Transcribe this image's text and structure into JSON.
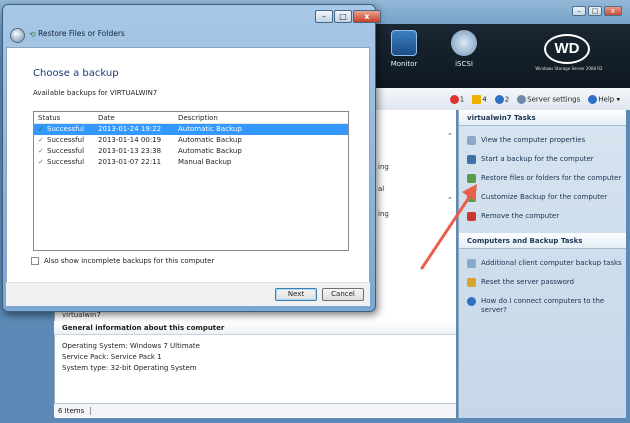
{
  "dialog": {
    "title": "Restore Files or Folders",
    "heading": "Choose a backup",
    "available_label": "Available backups for VIRTUALWIN7",
    "columns": [
      "Status",
      "Date",
      "Description"
    ],
    "rows": [
      {
        "status": "Successful",
        "date": "2013-01-24 19:22",
        "description": "Automatic Backup"
      },
      {
        "status": "Successful",
        "date": "2013-01-14 00:19",
        "description": "Automatic Backup"
      },
      {
        "status": "Successful",
        "date": "2013-01-13 23:38",
        "description": "Automatic Backup"
      },
      {
        "status": "Successful",
        "date": "2013-01-07 22:11",
        "description": "Manual Backup"
      }
    ],
    "incomplete_label": "Also show incomplete backups for this computer",
    "next_label": "Next",
    "cancel_label": "Cancel",
    "controls": {
      "minimize": "–",
      "maximize": "□",
      "close": "x"
    }
  },
  "dashboard": {
    "toolbar": {
      "monitor": "Monitor",
      "iscsi": "iSCSI"
    },
    "logo": "WD",
    "logo_sub": "Windows Storage Server 2008 R2",
    "status": {
      "errors": "1",
      "warnings": "4",
      "info": "2",
      "server_settings": "Server settings",
      "help": "Help"
    },
    "tasks_header": "virtualwin7 Tasks",
    "tasks": [
      "View the computer properties",
      "Start a backup for the computer",
      "Restore files or folders for the computer",
      "Customize Backup for the computer",
      "Remove the computer"
    ],
    "computers_header": "Computers and Backup Tasks",
    "computer_tasks": [
      "Additional client computer backup tasks",
      "Reset the server password",
      "How do I connect computers to the server?"
    ],
    "computer_name": "virtualwin7",
    "general_header": "General information about this computer",
    "general": [
      "Operating System: Windows 7 Ultimate",
      "Service Pack: Service Pack 1",
      "System type: 32-bit Operating System"
    ],
    "items_count": "6 Items",
    "snippets": [
      "ing",
      "al",
      "ing"
    ]
  },
  "colors": {
    "selection": "#3399ff",
    "arrow": "#e8604a",
    "heading": "#1b3a78"
  }
}
